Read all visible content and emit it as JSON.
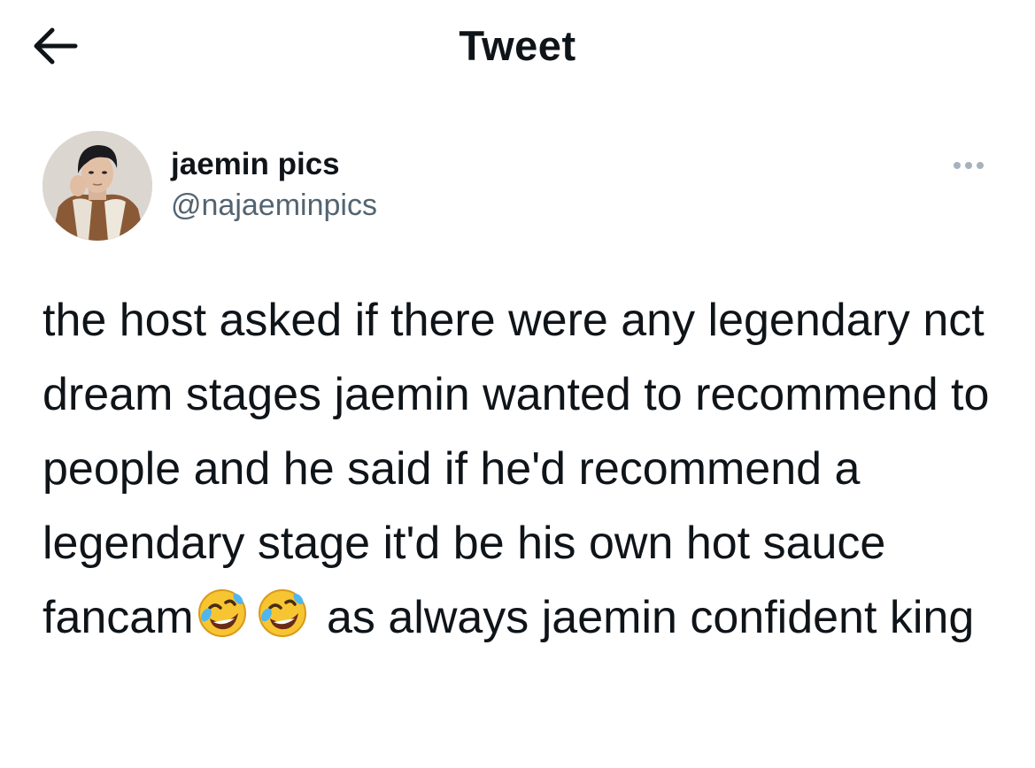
{
  "header": {
    "title": "Tweet",
    "back_icon": "arrow-left-icon"
  },
  "author": {
    "display_name": "jaemin pics",
    "handle": "@najaeminpics",
    "avatar_icon": "profile-photo"
  },
  "menu": {
    "icon": "more-horizontal-icon"
  },
  "tweet": {
    "text_before_emoji": "the host asked if there were any legendary nct dream stages jaemin wanted to recommend to people and he said if he'd recommend a legendary stage it'd be his own hot sauce fancam",
    "emoji_name": "rolling-on-floor-laughing-emoji",
    "emoji_count": 2,
    "text_after_emoji": " as always jaemin confident king"
  },
  "colors": {
    "text": "#0f1419",
    "secondary": "#536471",
    "background": "#ffffff"
  }
}
